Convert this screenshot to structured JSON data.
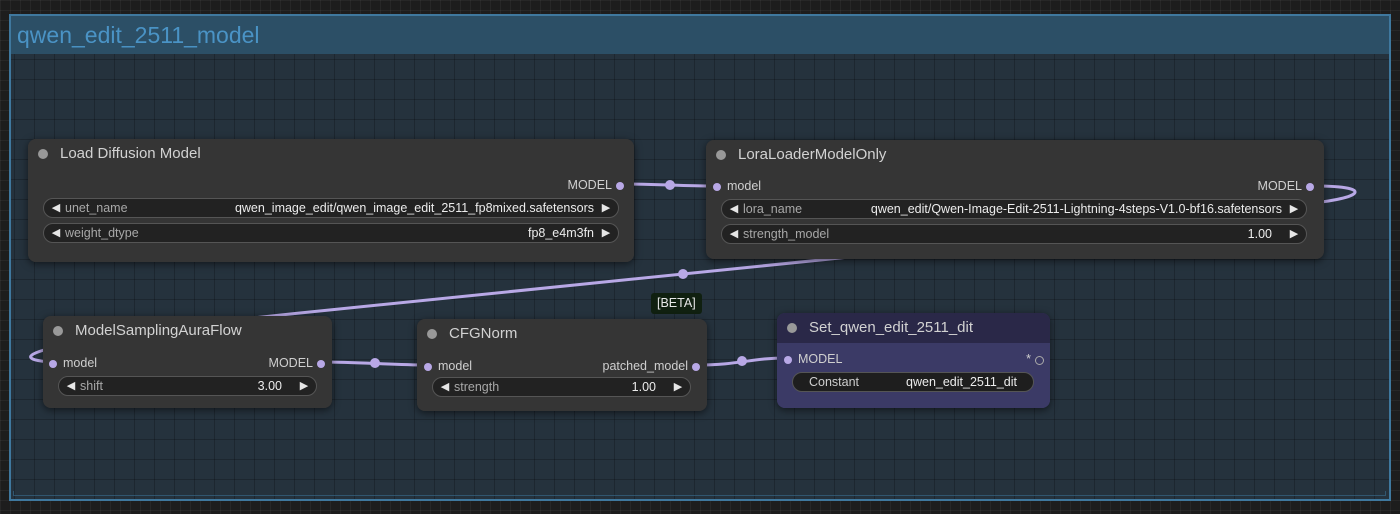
{
  "group": {
    "title": "qwen_edit_2511_model"
  },
  "badge": {
    "label": "[BETA]"
  },
  "nodes": {
    "load_diffusion": {
      "title": "Load Diffusion Model",
      "output": "MODEL",
      "widgets": [
        {
          "label": "unet_name",
          "value": "qwen_image_edit/qwen_image_edit_2511_fp8mixed.safetensors"
        },
        {
          "label": "weight_dtype",
          "value": "fp8_e4m3fn"
        }
      ]
    },
    "lora_loader": {
      "title": "LoraLoaderModelOnly",
      "input": "model",
      "output": "MODEL",
      "widgets": [
        {
          "label": "lora_name",
          "value": "qwen_edit/Qwen-Image-Edit-2511-Lightning-4steps-V1.0-bf16.safetensors"
        },
        {
          "label": "strength_model",
          "value": "1.00"
        }
      ]
    },
    "model_sampling": {
      "title": "ModelSamplingAuraFlow",
      "input": "model",
      "output": "MODEL",
      "widgets": [
        {
          "label": "shift",
          "value": "3.00"
        }
      ]
    },
    "cfg_norm": {
      "title": "CFGNorm",
      "input": "model",
      "output": "patched_model",
      "widgets": [
        {
          "label": "strength",
          "value": "1.00"
        }
      ]
    },
    "set_node": {
      "title": "Set_qwen_edit_2511_dit",
      "input": "MODEL",
      "output": "*",
      "widgets": [
        {
          "label": "Constant",
          "value": "qwen_edit_2511_dit"
        }
      ]
    }
  },
  "icons": {
    "left_arrow": "◀",
    "right_arrow": "▶"
  },
  "colors": {
    "link": "#b8a8e6",
    "group_border": "#3f789e",
    "group_title": "#4a93c5",
    "set_node_bg": "#3b3a66"
  }
}
